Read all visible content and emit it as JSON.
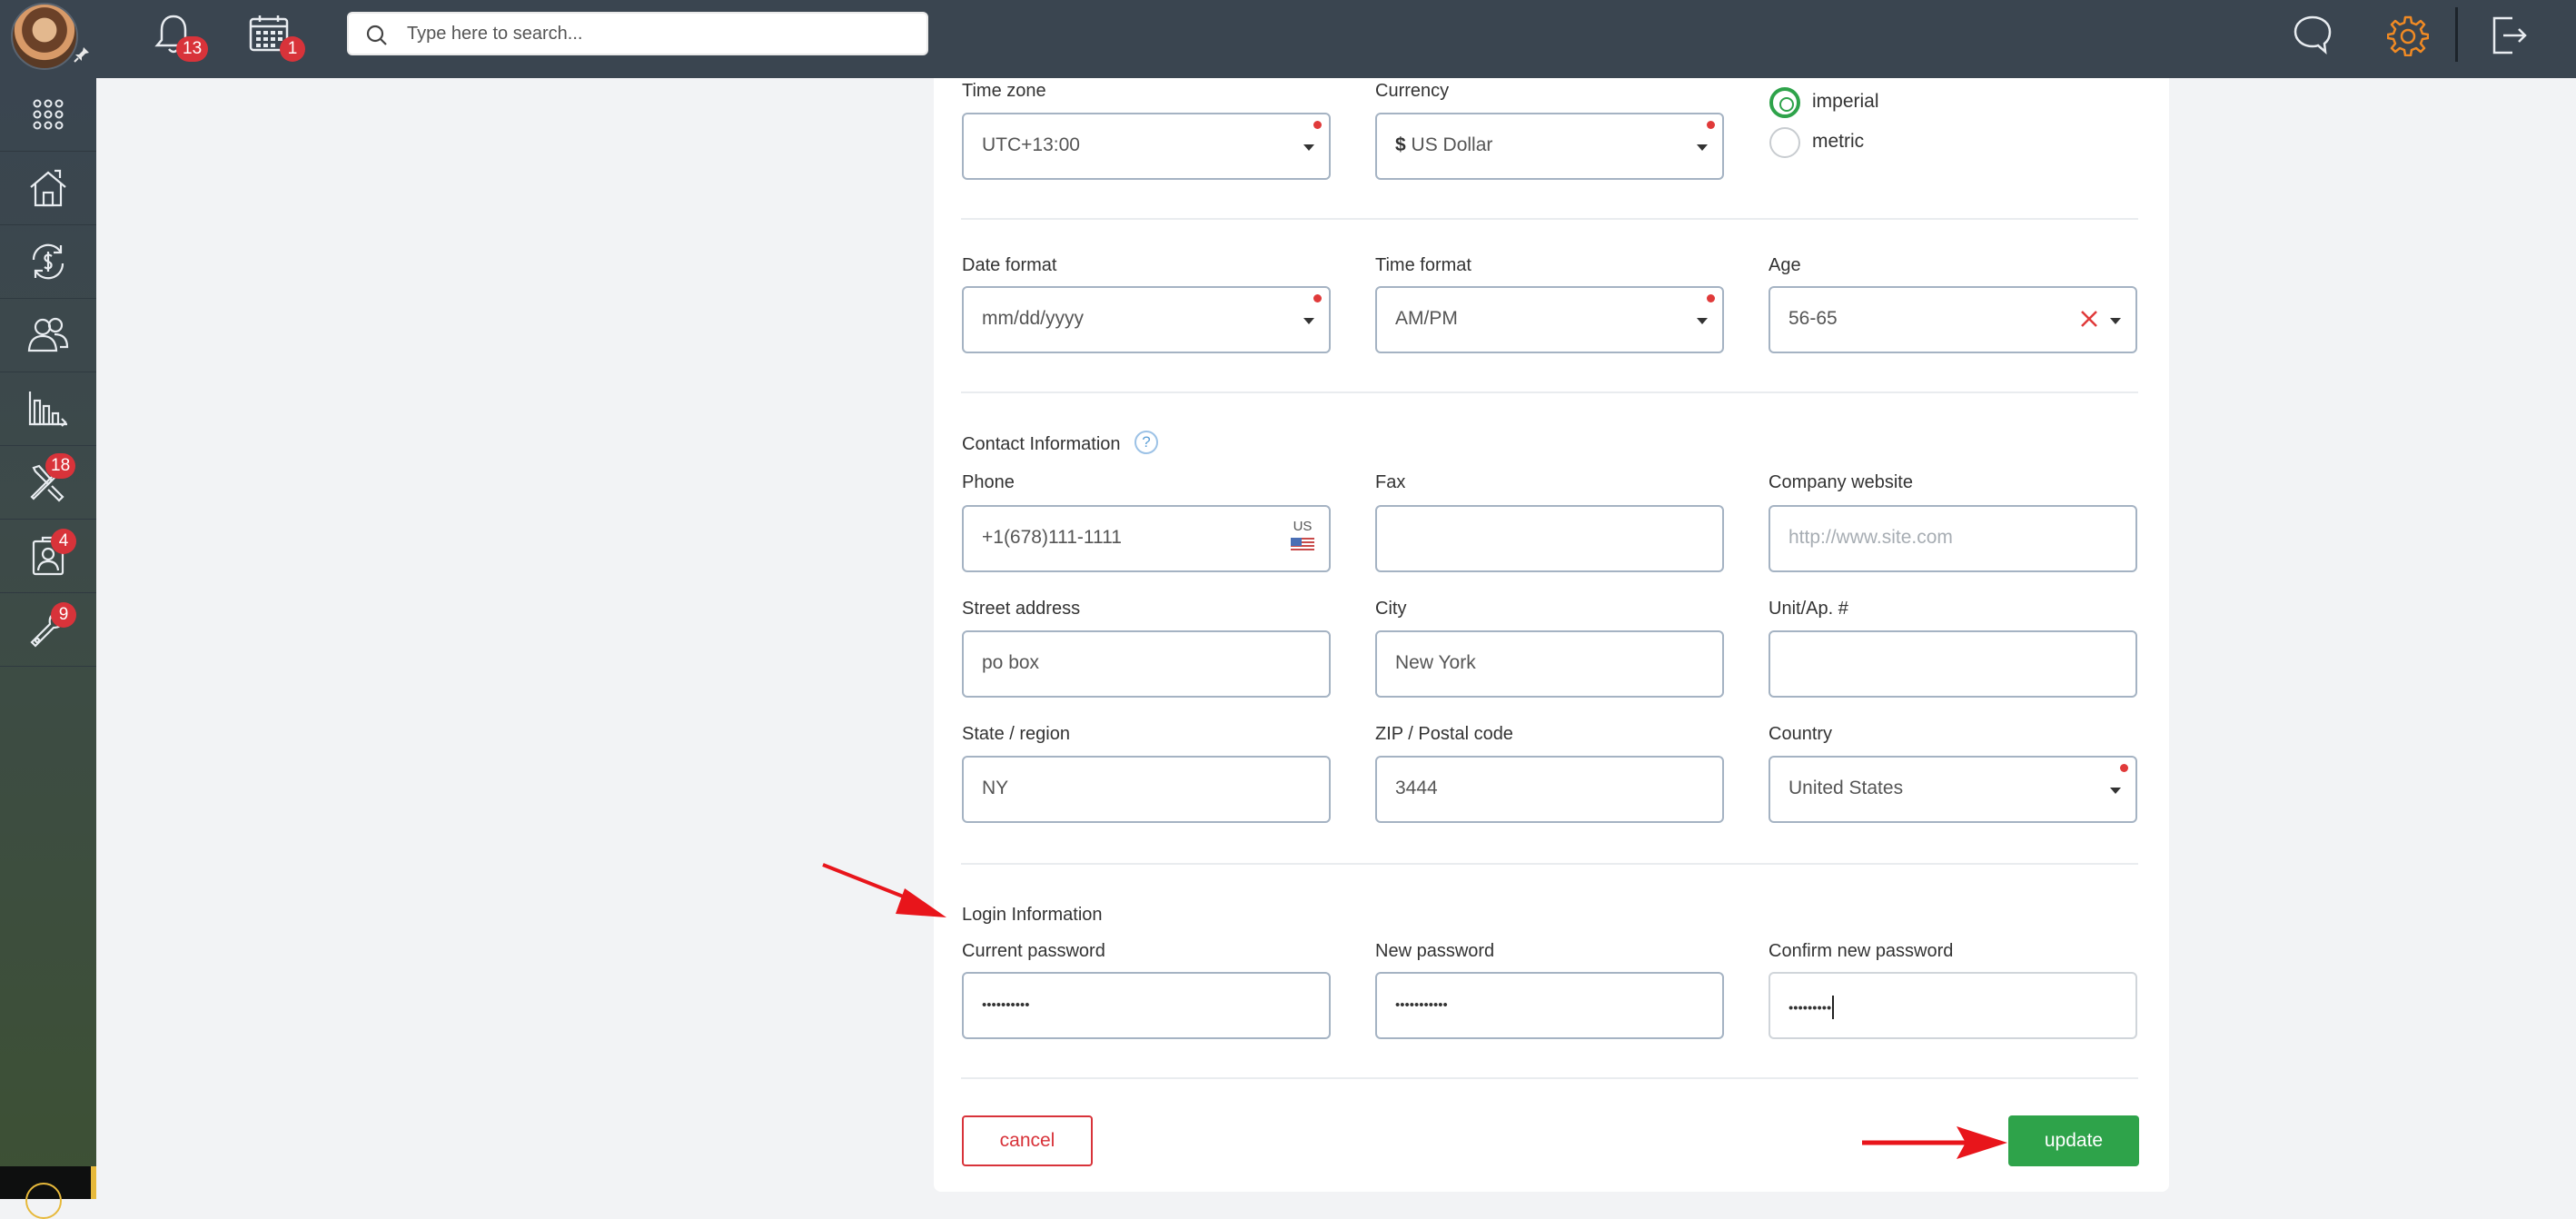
{
  "topbar": {
    "notifications_count": "13",
    "calendar_count": "1",
    "search_placeholder": "Type here to search..."
  },
  "sidebar": {
    "items": [
      {
        "icon": "apps-grid-icon"
      },
      {
        "icon": "house-icon"
      },
      {
        "icon": "money-exchange-icon"
      },
      {
        "icon": "contacts-icon"
      },
      {
        "icon": "bar-chart-icon"
      },
      {
        "icon": "tools-icon",
        "badge": "18"
      },
      {
        "icon": "person-card-icon",
        "badge": "4"
      },
      {
        "icon": "wrench-icon",
        "badge": "9"
      }
    ]
  },
  "form": {
    "timezone": {
      "label": "Time zone",
      "value": "UTC+13:00"
    },
    "currency": {
      "label": "Currency",
      "symbol": "$",
      "value": "US Dollar"
    },
    "units": {
      "imperial": "imperial",
      "metric": "metric",
      "selected": "imperial"
    },
    "date_format": {
      "label": "Date format",
      "value": "mm/dd/yyyy"
    },
    "time_format": {
      "label": "Time format",
      "value": "AM/PM"
    },
    "age": {
      "label": "Age",
      "value": "56-65"
    },
    "contact_title": "Contact Information",
    "help_glyph": "?",
    "phone": {
      "label": "Phone",
      "value": "+1(678)111-1111",
      "country": "US"
    },
    "fax": {
      "label": "Fax",
      "value": ""
    },
    "website": {
      "label": "Company website",
      "placeholder": "http://www.site.com"
    },
    "street": {
      "label": "Street address",
      "value": "po box"
    },
    "city": {
      "label": "City",
      "value": "New York"
    },
    "unit": {
      "label": "Unit/Ap. #",
      "value": ""
    },
    "state": {
      "label": "State / region",
      "value": "NY"
    },
    "zip": {
      "label": "ZIP / Postal code",
      "value": "3444"
    },
    "country": {
      "label": "Country",
      "value": "United States"
    },
    "login_title": "Login Information",
    "current_password": {
      "label": "Current password",
      "value": "••••••••••"
    },
    "new_password": {
      "label": "New password",
      "value": "•••••••••••"
    },
    "confirm_password": {
      "label": "Confirm new password",
      "value": "•••••••••"
    }
  },
  "actions": {
    "cancel": "cancel",
    "update": "update"
  },
  "colors": {
    "accent_green": "#2ea34a",
    "danger_red": "#d8333a",
    "topbar": "#3a4550",
    "settings_orange": "#f08a24",
    "annotation_arrow": "#e8151b"
  }
}
